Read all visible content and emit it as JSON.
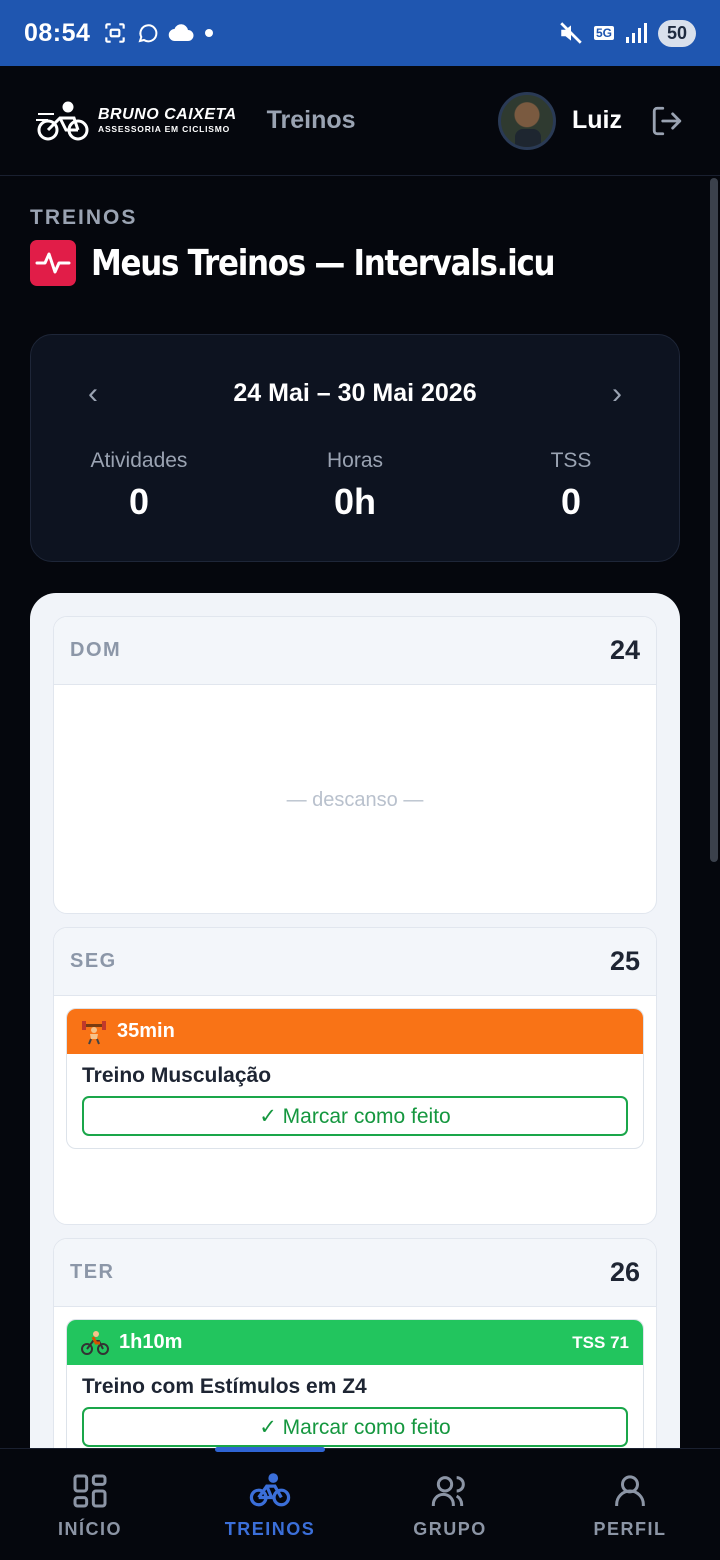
{
  "status_bar": {
    "time": "08:54",
    "battery": "50",
    "network": "5G"
  },
  "header": {
    "logo_line1": "BRUNO CAIXETA",
    "logo_line2": "ASSESSORIA EM CICLISMO",
    "nav_title": "Treinos",
    "username": "Luiz"
  },
  "page": {
    "section_label": "TREINOS",
    "title": "Meus Treinos — Intervals.icu"
  },
  "week": {
    "range": "24 Mai – 30 Mai 2026",
    "prev_icon": "chevron-left-icon",
    "next_icon": "chevron-right-icon",
    "stats": [
      {
        "label": "Atividades",
        "value": "0"
      },
      {
        "label": "Horas",
        "value": "0h"
      },
      {
        "label": "TSS",
        "value": "0"
      }
    ]
  },
  "days": [
    {
      "name": "DOM",
      "number": "24",
      "rest_text": "— descanso —"
    },
    {
      "name": "SEG",
      "number": "25",
      "workout": {
        "icon": "weightlifter-icon",
        "duration": "35min",
        "title": "Treino Musculação",
        "button": "✓ Marcar como feito",
        "color": "#f97316"
      }
    },
    {
      "name": "TER",
      "number": "26",
      "workout": {
        "icon": "cyclist-icon",
        "duration": "1h10m",
        "tss": "TSS 71",
        "title": "Treino com Estímulos em Z4",
        "button": "✓ Marcar como feito",
        "color": "#22c55e"
      }
    }
  ],
  "bottom_nav": [
    {
      "label": "INÍCIO",
      "icon": "grid-icon"
    },
    {
      "label": "TREINOS",
      "icon": "bike-icon",
      "active": true
    },
    {
      "label": "GRUPO",
      "icon": "users-icon"
    },
    {
      "label": "PERFIL",
      "icon": "user-icon"
    }
  ],
  "colors": {
    "accent": "#2f64d3",
    "status_bar": "#1f56b0",
    "brand_red": "#e11d48",
    "done_green": "#1aa64a"
  }
}
